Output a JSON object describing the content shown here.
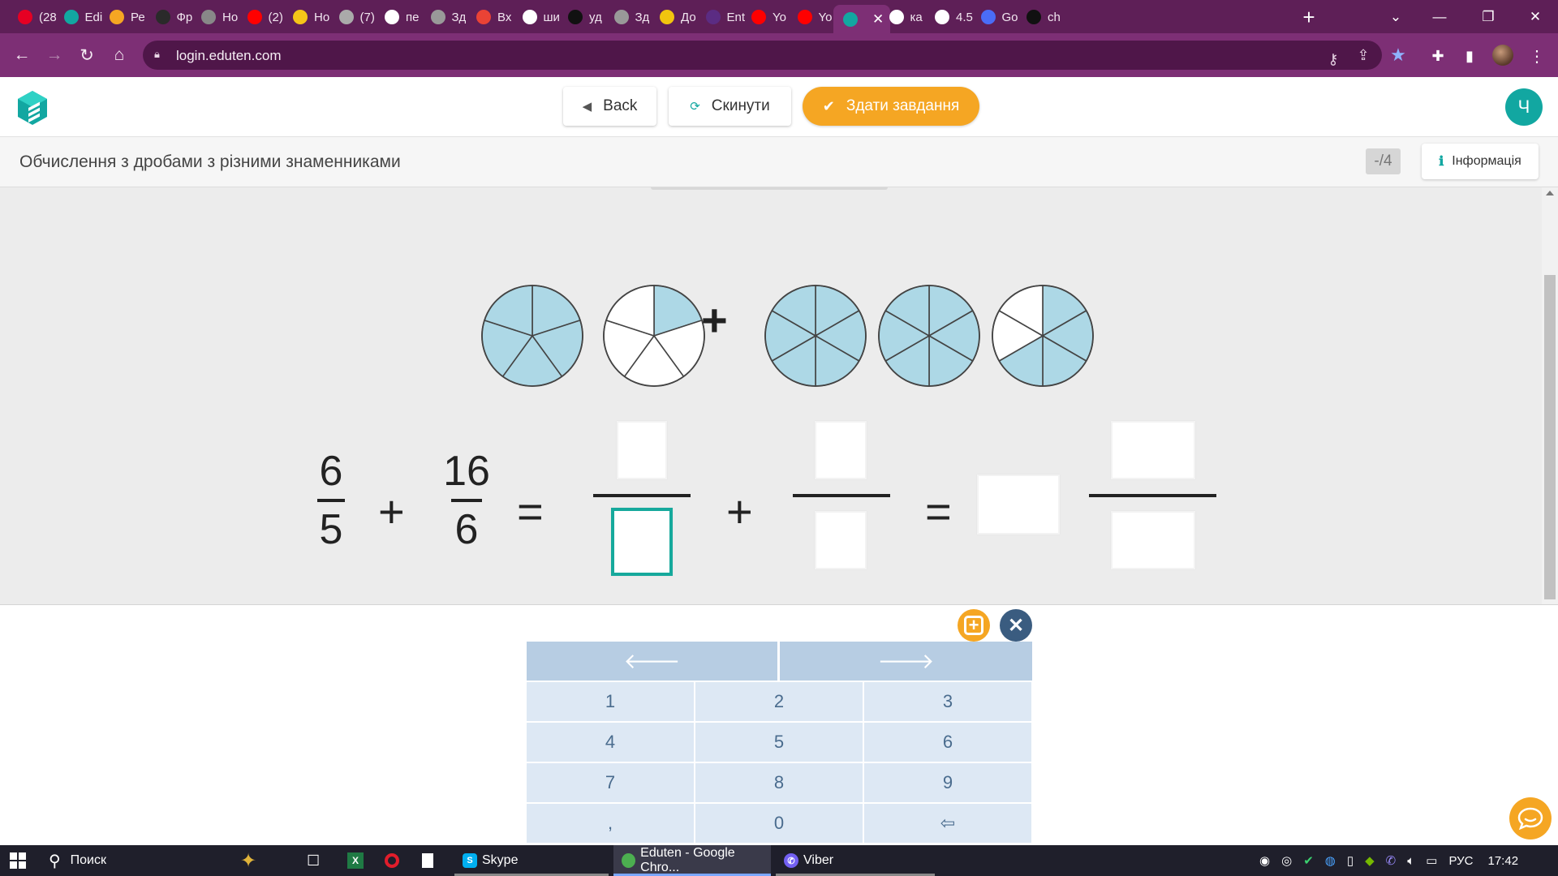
{
  "browser": {
    "tabs": [
      {
        "label": "(28",
        "icon": "pinterest-icon",
        "color": "#e60023"
      },
      {
        "label": "Edi",
        "icon": "eduten-icon",
        "color": "#12a7a1"
      },
      {
        "label": "Ре",
        "icon": "bell-icon",
        "color": "#f5a623"
      },
      {
        "label": "Фр",
        "icon": "d-letter-icon",
        "color": "#2a2a2a"
      },
      {
        "label": "Но",
        "icon": "chrome-icon",
        "color": "#888888"
      },
      {
        "label": "(2)",
        "icon": "youtube-icon",
        "color": "#ff0000"
      },
      {
        "label": "Но",
        "icon": "bulb-icon",
        "color": "#f5c518"
      },
      {
        "label": "(7)",
        "icon": "note-icon",
        "color": "#aaaaaa"
      },
      {
        "label": "пе",
        "icon": "google-icon",
        "color": "#ffffff"
      },
      {
        "label": "Зд",
        "icon": "globe-icon",
        "color": "#999999"
      },
      {
        "label": "Вх",
        "icon": "gmail-icon",
        "color": "#ea4335"
      },
      {
        "label": "ши",
        "icon": "google-icon",
        "color": "#ffffff"
      },
      {
        "label": "уд",
        "icon": "tiktok-icon",
        "color": "#111111"
      },
      {
        "label": "Зд",
        "icon": "globe-icon",
        "color": "#999999"
      },
      {
        "label": "До",
        "icon": "card-icon",
        "color": "#f1c40f"
      },
      {
        "label": "Ent",
        "icon": "ent-icon",
        "color": "#5b2c83"
      },
      {
        "label": "Yo",
        "icon": "youtube-icon",
        "color": "#ff0000"
      },
      {
        "label": "Yo",
        "icon": "youtube-icon",
        "color": "#ff0000"
      },
      {
        "label": "",
        "icon": "eduten-icon",
        "color": "#12a7a1",
        "active": true
      },
      {
        "label": "ка",
        "icon": "google-icon",
        "color": "#ffffff"
      },
      {
        "label": "4.5",
        "icon": "google-icon",
        "color": "#ffffff"
      },
      {
        "label": "Go",
        "icon": "google-lens-icon",
        "color": "#4a6cf7"
      },
      {
        "label": "ch",
        "icon": "three-icon",
        "color": "#111111"
      }
    ],
    "url": "login.eduten.com"
  },
  "header": {
    "back_label": "Back",
    "reset_label": "Скинути",
    "submit_label": "Здати завдання",
    "user_initial": "Ч"
  },
  "subheader": {
    "title": "Обчислення з дробами з різними знаменниками",
    "score": "-/4",
    "info_label": "Інформація"
  },
  "task": {
    "pies_left": [
      {
        "parts": 5,
        "filled": 5
      },
      {
        "parts": 5,
        "filled": 1
      }
    ],
    "pies_right": [
      {
        "parts": 6,
        "filled": 6
      },
      {
        "parts": 6,
        "filled": 6
      },
      {
        "parts": 6,
        "filled": 4
      }
    ],
    "plus": "+",
    "equation": {
      "frac1_num": "6",
      "frac1_den": "5",
      "op1": "+",
      "frac2_num": "16",
      "frac2_den": "6",
      "eq1": "=",
      "op2": "+",
      "eq2": "="
    },
    "colors": {
      "pie_fill": "#add8e6",
      "pie_empty": "#ffffff",
      "focus": "#16a99c"
    }
  },
  "keypad": {
    "keys": [
      "1",
      "2",
      "3",
      "4",
      "5",
      "6",
      "7",
      "8",
      "9",
      ",",
      "0",
      "⇦"
    ]
  },
  "taskbar": {
    "search_label": "Поиск",
    "apps": [
      {
        "label": "Skype"
      },
      {
        "label": "Eduten - Google Chro..."
      },
      {
        "label": "Viber"
      }
    ],
    "lang": "РУС",
    "time": "17:42"
  }
}
